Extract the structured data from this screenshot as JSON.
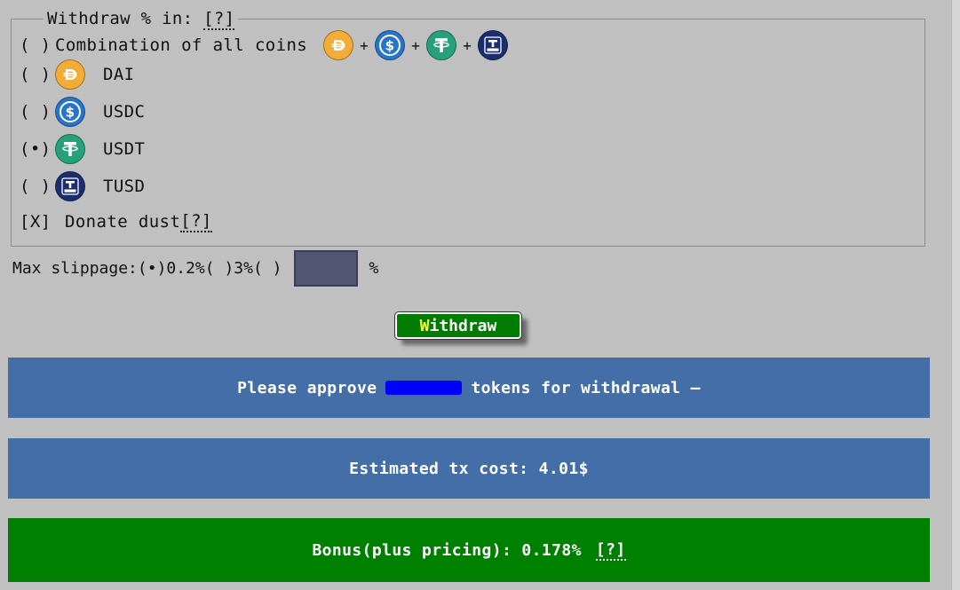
{
  "withdraw_box": {
    "legend": "Withdraw % in: ",
    "help": "[?]",
    "options": [
      {
        "radio": "( )",
        "label": "Combination of all coins"
      },
      {
        "radio": "( )",
        "label": "DAI",
        "icon": "dai-coin-icon"
      },
      {
        "radio": "( )",
        "label": "USDC",
        "icon": "usdc-coin-icon"
      },
      {
        "radio": "(•)",
        "label": "USDT",
        "icon": "usdt-coin-icon"
      },
      {
        "radio": "( )",
        "label": "TUSD",
        "icon": "tusd-coin-icon"
      }
    ],
    "combo_plus": "+",
    "donate": {
      "checkbox": "[X]",
      "label": "Donate dust",
      "help": "[?]"
    }
  },
  "slippage": {
    "label": "Max slippage:",
    "opt1_radio": "(•)",
    "opt1_value": "0.2%",
    "opt2_radio": "( )",
    "opt2_value": "3%",
    "opt3_radio": "( )",
    "custom_value": "",
    "unit": "%"
  },
  "withdraw_button": {
    "hotkey": "W",
    "rest": "ithdraw"
  },
  "banners": {
    "approve_prefix": "Please approve",
    "approve_suffix": "tokens for withdrawal –",
    "estimate": "Estimated tx cost: 4.01$",
    "bonus": "Bonus(plus pricing): 0.178%",
    "bonus_help": "[?]"
  },
  "colors": {
    "background": "#c0c0c0",
    "banner_blue": "#436ea8",
    "banner_green": "#008000",
    "button_green": "#007c00",
    "redaction": "#0000ff"
  }
}
